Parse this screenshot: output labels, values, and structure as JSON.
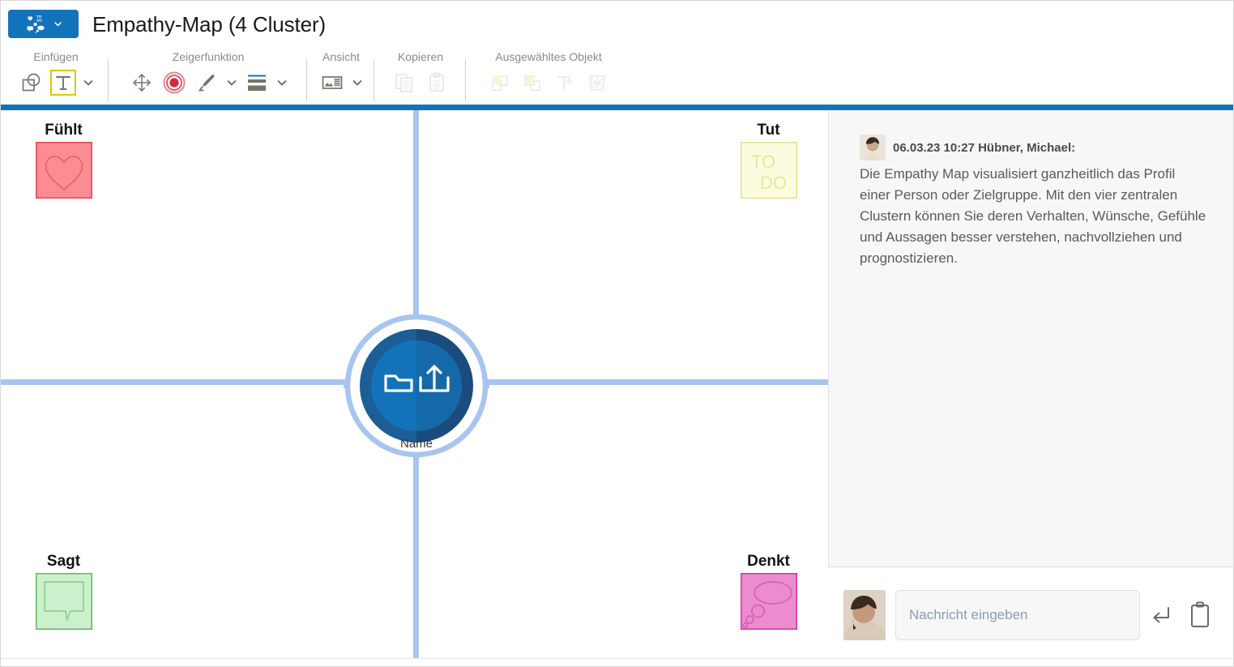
{
  "window": {
    "title": "Empathy-Map (4 Cluster)",
    "logo_icon": "empathy-map-logo-icon",
    "logo_caret_icon": "chevron-down-icon",
    "accent_color": "#1273ba",
    "divider_color": "#a8c5f0"
  },
  "ribbon": {
    "groups": [
      {
        "label": "Einfügen",
        "items": [
          {
            "name": "insert-shape-button",
            "icon": "shapes-icon",
            "state": "enabled"
          },
          {
            "name": "insert-text-button",
            "icon": "text-tool-icon",
            "state": "active"
          },
          {
            "name": "insert-dropdown",
            "icon": "chevron-down-icon",
            "state": "enabled"
          }
        ]
      },
      {
        "label": "Zeigerfunktion",
        "items": [
          {
            "name": "move-tool-button",
            "icon": "move-arrows-icon",
            "state": "enabled"
          },
          {
            "name": "marker-target-button",
            "icon": "target-circle-icon",
            "state": "enabled"
          },
          {
            "name": "pen-tool-button",
            "icon": "pen-icon",
            "state": "enabled"
          },
          {
            "name": "pen-dropdown",
            "icon": "chevron-down-icon",
            "state": "enabled"
          },
          {
            "name": "line-style-button",
            "icon": "line-weight-icon",
            "state": "enabled"
          },
          {
            "name": "line-style-dropdown",
            "icon": "chevron-down-icon",
            "state": "enabled"
          }
        ]
      },
      {
        "label": "Ansicht",
        "items": [
          {
            "name": "view-layout-button",
            "icon": "layout-view-icon",
            "state": "enabled"
          },
          {
            "name": "view-dropdown",
            "icon": "chevron-down-icon",
            "state": "enabled"
          }
        ]
      },
      {
        "label": "Kopieren",
        "items": [
          {
            "name": "copy-button",
            "icon": "copy-icon",
            "state": "disabled"
          },
          {
            "name": "paste-button",
            "icon": "paste-icon",
            "state": "disabled"
          }
        ]
      },
      {
        "label": "Ausgewähltes Objekt",
        "items": [
          {
            "name": "bring-to-front-button",
            "icon": "bring-to-front-icon",
            "state": "disabled"
          },
          {
            "name": "send-to-back-button",
            "icon": "send-to-back-icon",
            "state": "disabled"
          },
          {
            "name": "object-text-button",
            "icon": "text-object-icon",
            "state": "disabled"
          },
          {
            "name": "delete-object-button",
            "icon": "delete-hatched-icon",
            "state": "disabled"
          }
        ]
      }
    ]
  },
  "canvas": {
    "quadrants": [
      {
        "key": "feels",
        "title": "Fühlt",
        "icon": "heart-icon",
        "fill": "#fb8c93",
        "stroke": "#e8474f"
      },
      {
        "key": "does",
        "title": "Tut",
        "icon": "todo-note-icon",
        "label": "TO DO",
        "fill": "#fbfbdf",
        "stroke": "#e3e38a"
      },
      {
        "key": "says",
        "title": "Sagt",
        "icon": "speech-bubble-icon",
        "fill": "#ccf0cc",
        "stroke": "#63b563"
      },
      {
        "key": "thinks",
        "title": "Denkt",
        "icon": "thought-bubble-icon",
        "fill": "#eb8bd0",
        "stroke": "#d6319f"
      }
    ],
    "persona": {
      "label": "Name",
      "icons": [
        "folder-open-icon",
        "upload-icon"
      ],
      "ring_color": "#a8c5f0",
      "left_fill": "#1b5f96",
      "right_fill": "#1273ba"
    }
  },
  "panel": {
    "resize_icon": "panel-resize-icon",
    "collapse_icon": "chevron-up-icon",
    "comments": [
      {
        "avatar": "user-avatar",
        "meta": "06.03.23 10:27 Hübner, Michael:",
        "body": "Die Empathy Map visualisiert ganzheitlich das Profil einer Person oder Zielgruppe. Mit den vier zentralen Clustern können Sie deren Verhalten, Wünsche, Gefühle und Aussagen besser verstehen, nachvollziehen und prognostizieren."
      }
    ],
    "composer": {
      "avatar": "current-user-avatar",
      "placeholder": "Nachricht eingeben",
      "value": "",
      "send_icon": "enter-return-icon",
      "clipboard_icon": "clipboard-icon"
    }
  }
}
